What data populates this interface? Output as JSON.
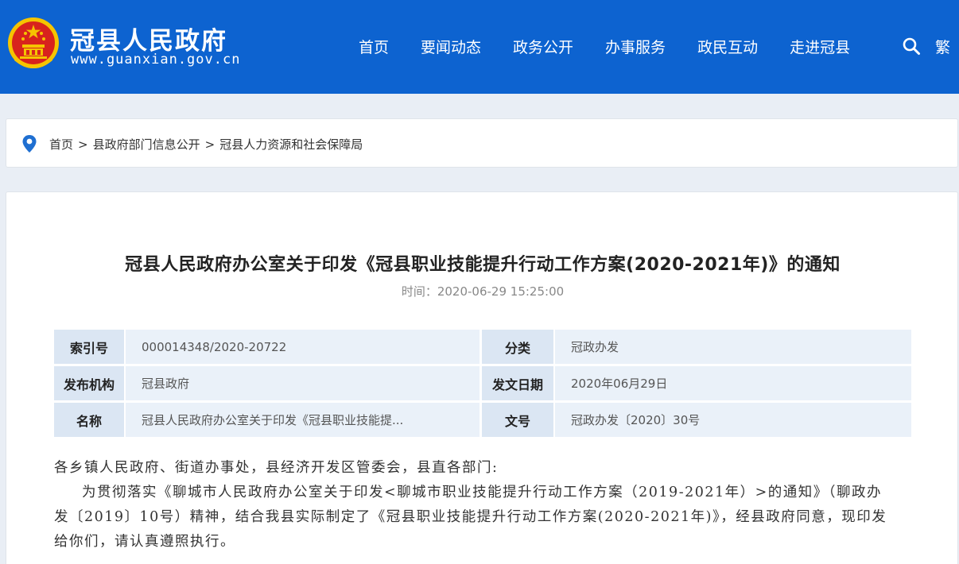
{
  "header": {
    "site_name": "冠县人民政府",
    "site_url": "www.guanxian.gov.cn",
    "nav": [
      "首页",
      "要闻动态",
      "政务公开",
      "办事服务",
      "政民互动",
      "走进冠县"
    ],
    "search_icon": "search-icon",
    "traditional_label": "繁",
    "colors": {
      "bar": "#0d63d0",
      "emblem_red": "#d8231d",
      "emblem_gold": "#f5c400"
    }
  },
  "breadcrumb": {
    "icon": "location-pin-icon",
    "items": [
      "首页",
      "县政府部门信息公开",
      "冠县人力资源和社会保障局"
    ],
    "separator": ">"
  },
  "article": {
    "title": "冠县人民政府办公室关于印发《冠县职业技能提升行动工作方案(2020-2021年)》的通知",
    "time_label": "时间：",
    "time_value": "2020-06-29 15:25:00",
    "meta": [
      {
        "label": "索引号",
        "value": "000014348/2020-20722",
        "label2": "分类",
        "value2": "冠政办发"
      },
      {
        "label": "发布机构",
        "value": "冠县政府",
        "label2": "发文日期",
        "value2": "2020年06月29日"
      },
      {
        "label": "名称",
        "value": "冠县人民政府办公室关于印发《冠县职业技能提...",
        "label2": "文号",
        "value2": "冠政办发〔2020〕30号"
      }
    ],
    "salutation": "各乡镇人民政府、街道办事处，县经济开发区管委会，县直各部门:",
    "paragraph": "为贯彻落实《聊城市人民政府办公室关于印发<聊城市职业技能提升行动工作方案（2019-2021年）>的通知》（聊政办发〔2019〕10号）精神，结合我县实际制定了《冠县职业技能提升行动工作方案(2020-2021年)》，经县政府同意，现印发给你们，请认真遵照执行。"
  }
}
